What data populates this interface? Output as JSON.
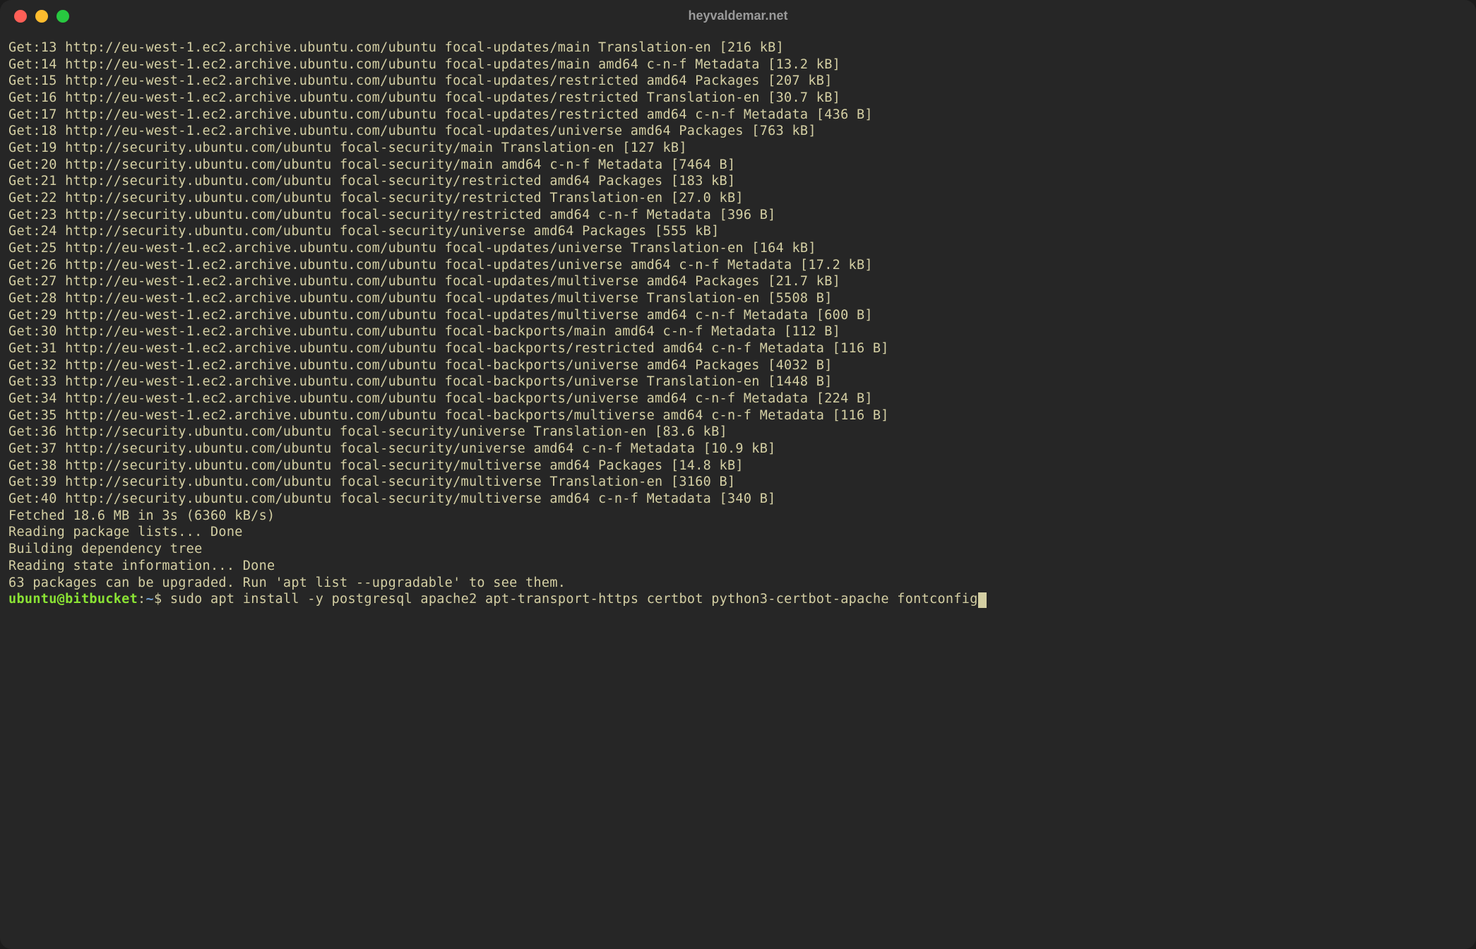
{
  "window": {
    "title": "heyvaldemar.net"
  },
  "output_lines": [
    "Get:13 http://eu-west-1.ec2.archive.ubuntu.com/ubuntu focal-updates/main Translation-en [216 kB]",
    "Get:14 http://eu-west-1.ec2.archive.ubuntu.com/ubuntu focal-updates/main amd64 c-n-f Metadata [13.2 kB]",
    "Get:15 http://eu-west-1.ec2.archive.ubuntu.com/ubuntu focal-updates/restricted amd64 Packages [207 kB]",
    "Get:16 http://eu-west-1.ec2.archive.ubuntu.com/ubuntu focal-updates/restricted Translation-en [30.7 kB]",
    "Get:17 http://eu-west-1.ec2.archive.ubuntu.com/ubuntu focal-updates/restricted amd64 c-n-f Metadata [436 B]",
    "Get:18 http://eu-west-1.ec2.archive.ubuntu.com/ubuntu focal-updates/universe amd64 Packages [763 kB]",
    "Get:19 http://security.ubuntu.com/ubuntu focal-security/main Translation-en [127 kB]",
    "Get:20 http://security.ubuntu.com/ubuntu focal-security/main amd64 c-n-f Metadata [7464 B]",
    "Get:21 http://security.ubuntu.com/ubuntu focal-security/restricted amd64 Packages [183 kB]",
    "Get:22 http://security.ubuntu.com/ubuntu focal-security/restricted Translation-en [27.0 kB]",
    "Get:23 http://security.ubuntu.com/ubuntu focal-security/restricted amd64 c-n-f Metadata [396 B]",
    "Get:24 http://security.ubuntu.com/ubuntu focal-security/universe amd64 Packages [555 kB]",
    "Get:25 http://eu-west-1.ec2.archive.ubuntu.com/ubuntu focal-updates/universe Translation-en [164 kB]",
    "Get:26 http://eu-west-1.ec2.archive.ubuntu.com/ubuntu focal-updates/universe amd64 c-n-f Metadata [17.2 kB]",
    "Get:27 http://eu-west-1.ec2.archive.ubuntu.com/ubuntu focal-updates/multiverse amd64 Packages [21.7 kB]",
    "Get:28 http://eu-west-1.ec2.archive.ubuntu.com/ubuntu focal-updates/multiverse Translation-en [5508 B]",
    "Get:29 http://eu-west-1.ec2.archive.ubuntu.com/ubuntu focal-updates/multiverse amd64 c-n-f Metadata [600 B]",
    "Get:30 http://eu-west-1.ec2.archive.ubuntu.com/ubuntu focal-backports/main amd64 c-n-f Metadata [112 B]",
    "Get:31 http://eu-west-1.ec2.archive.ubuntu.com/ubuntu focal-backports/restricted amd64 c-n-f Metadata [116 B]",
    "Get:32 http://eu-west-1.ec2.archive.ubuntu.com/ubuntu focal-backports/universe amd64 Packages [4032 B]",
    "Get:33 http://eu-west-1.ec2.archive.ubuntu.com/ubuntu focal-backports/universe Translation-en [1448 B]",
    "Get:34 http://eu-west-1.ec2.archive.ubuntu.com/ubuntu focal-backports/universe amd64 c-n-f Metadata [224 B]",
    "Get:35 http://eu-west-1.ec2.archive.ubuntu.com/ubuntu focal-backports/multiverse amd64 c-n-f Metadata [116 B]",
    "Get:36 http://security.ubuntu.com/ubuntu focal-security/universe Translation-en [83.6 kB]",
    "Get:37 http://security.ubuntu.com/ubuntu focal-security/universe amd64 c-n-f Metadata [10.9 kB]",
    "Get:38 http://security.ubuntu.com/ubuntu focal-security/multiverse amd64 Packages [14.8 kB]",
    "Get:39 http://security.ubuntu.com/ubuntu focal-security/multiverse Translation-en [3160 B]",
    "Get:40 http://security.ubuntu.com/ubuntu focal-security/multiverse amd64 c-n-f Metadata [340 B]",
    "Fetched 18.6 MB in 3s (6360 kB/s)",
    "Reading package lists... Done",
    "Building dependency tree",
    "Reading state information... Done",
    "63 packages can be upgraded. Run 'apt list --upgradable' to see them."
  ],
  "prompt": {
    "user": "ubuntu",
    "at": "@",
    "host": "bitbucket",
    "colon": ":",
    "path": "~",
    "dollar": "$",
    "command": "sudo apt install -y postgresql apache2 apt-transport-https certbot python3-certbot-apache fontconfig"
  }
}
